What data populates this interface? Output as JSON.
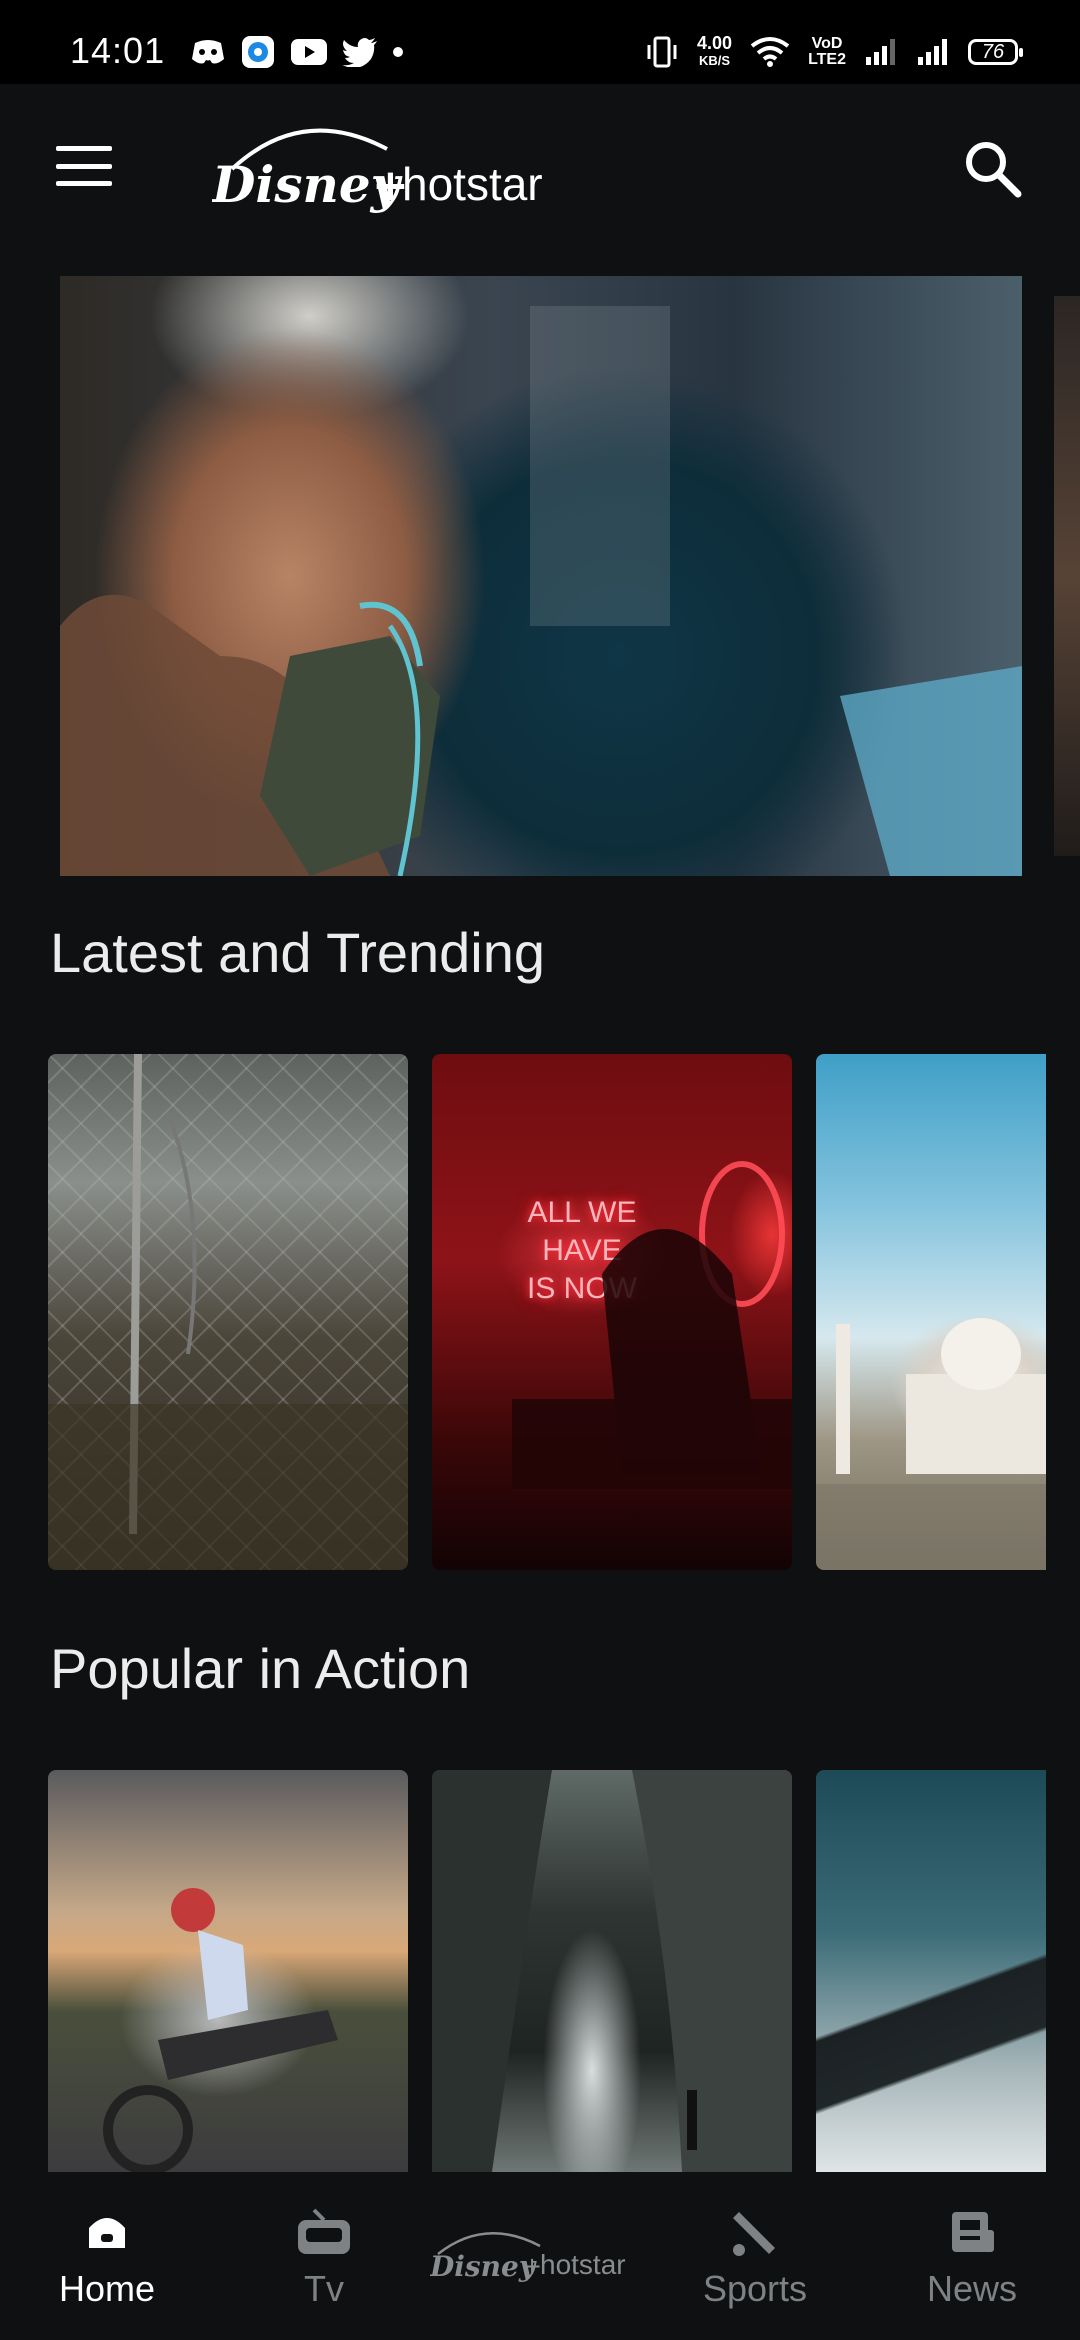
{
  "status_bar": {
    "time": "14:01",
    "network_speed": "4.00",
    "network_speed_unit": "KB/S",
    "volte_top": "VoD",
    "volte_bottom": "LTE2",
    "battery": "76",
    "left_icons": [
      "discord-icon",
      "messenger-icon",
      "youtube-icon",
      "twitter-icon",
      "dot-icon"
    ],
    "right_icons": [
      "vibrate-icon",
      "wifi-icon",
      "signal-icon",
      "signal-icon"
    ]
  },
  "header": {
    "logo_text": "hotstar",
    "menu_icon": "hamburger-icon",
    "search_icon": "search-icon"
  },
  "sections": [
    {
      "title": "Latest and Trending"
    },
    {
      "title": "Popular in Action"
    }
  ],
  "neon_sign": [
    "ALL WE",
    "HAVE",
    "IS NOW"
  ],
  "bottom_nav": {
    "items": [
      {
        "label": "Home",
        "icon": "home-icon",
        "active": true
      },
      {
        "label": "Tv",
        "icon": "tv-icon",
        "active": false
      },
      {
        "label": "hotstar",
        "icon": "disney-hotstar-logo",
        "active": false
      },
      {
        "label": "Sports",
        "icon": "sports-icon",
        "active": false
      },
      {
        "label": "News",
        "icon": "news-icon",
        "active": false
      }
    ]
  },
  "colors": {
    "background": "#0e1011",
    "active_nav": "#ffffff",
    "inactive_nav": "#7e8285"
  }
}
